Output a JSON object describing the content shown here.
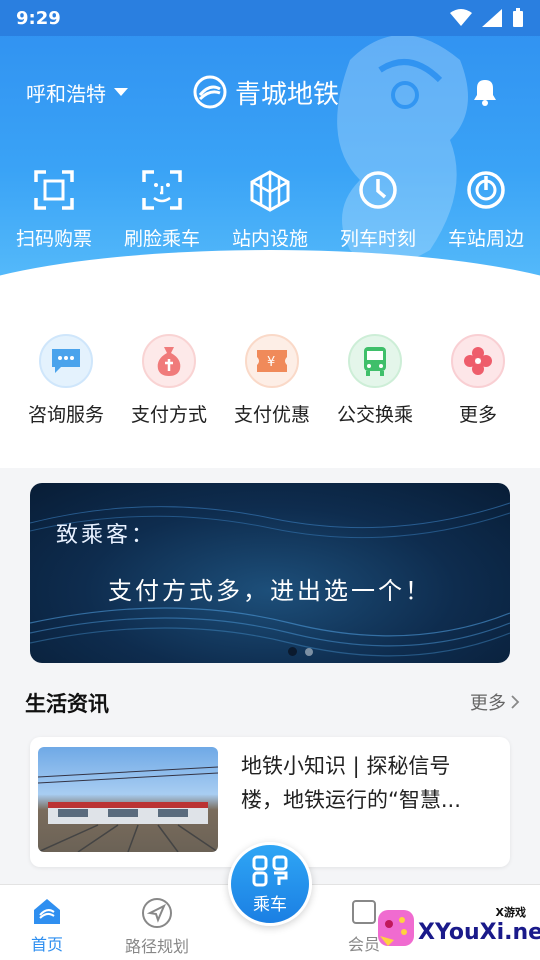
{
  "status_bar": {
    "time": "9:29"
  },
  "header": {
    "city": "呼和浩特",
    "brand": "青城地铁"
  },
  "quick_actions": [
    {
      "label": "扫码购票",
      "icon": "scan-icon"
    },
    {
      "label": "刷脸乘车",
      "icon": "face-scan-icon"
    },
    {
      "label": "站内设施",
      "icon": "facilities-icon"
    },
    {
      "label": "列车时刻",
      "icon": "clock-icon"
    },
    {
      "label": "车站周边",
      "icon": "nearby-icon"
    }
  ],
  "services": [
    {
      "label": "咨询服务",
      "icon": "chat-icon",
      "color": "#4aa3ec"
    },
    {
      "label": "支付方式",
      "icon": "money-bag-icon",
      "color": "#f07b7b"
    },
    {
      "label": "支付优惠",
      "icon": "coupon-icon",
      "color": "#f08a5a"
    },
    {
      "label": "公交换乘",
      "icon": "bus-icon",
      "color": "#3fbf6a"
    },
    {
      "label": "更多",
      "icon": "more-icon",
      "color": "#ee5d6b"
    }
  ],
  "banner": {
    "line1": "致乘客：",
    "line2": "支付方式多，进出选一个！"
  },
  "news": {
    "title": "生活资讯",
    "more": "更多",
    "items": [
      {
        "text": "地铁小知识 | 探秘信号楼，地铁运行的“智慧..."
      }
    ]
  },
  "tabbar": {
    "home": "首页",
    "route": "路径规划",
    "ride": "乘车",
    "member": "会员"
  },
  "watermark": {
    "small": "X游戏",
    "text": "XYouXi.net"
  },
  "colors": {
    "primary": "#2f8ff0",
    "banner_bg": "#0e2c4e"
  }
}
